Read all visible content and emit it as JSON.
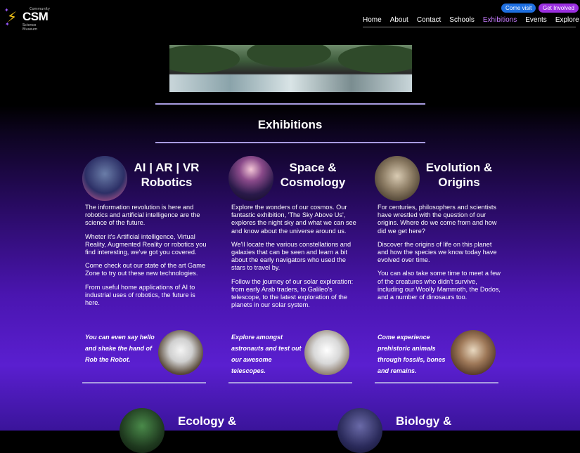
{
  "header": {
    "logo": {
      "top_text": "Community",
      "main": "CSM",
      "sub_text": "Science Museum"
    },
    "buttons": {
      "visit": "Come visit",
      "involved": "Get Involved"
    },
    "nav": [
      "Home",
      "About",
      "Contact",
      "Schools",
      "Exhibitions",
      "Events",
      "Explore"
    ],
    "active_nav": "Exhibitions"
  },
  "page": {
    "title": "Exhibitions"
  },
  "columns": [
    {
      "title_line1": "AI | AR | VR",
      "title_line2": "Robotics",
      "paragraphs": [
        "The information revolution is here and robotics and artificial intelligence are the science of the future.",
        "Wheter it's Artificial intelligence, Virtual Reality, Augmented Reality or robotics you find interesting, we've got you covered.",
        "Come check out our state of the art Game Zone to try out these new technologies.",
        "From useful home applications of AI to industrial uses of robotics, the future is here."
      ],
      "quote": "You can even say hello and shake the hand of Rob the Robot."
    },
    {
      "title_line1": "Space &",
      "title_line2": "Cosmology",
      "paragraphs": [
        "Explore the wonders of our cosmos. Our fantastic exhibition, 'The Sky Above Us', explores the night sky and what we can see and know about the universe around us.",
        "We'll locate the various constellations and galaxies that can be seen and learn a bit about the early navigators who used the stars to travel by.",
        "Follow the journey of our solar exploration: from early Arab traders, to Galileo's telescope, to the latest exploration of the planets in our solar system."
      ],
      "quote": "Explore amongst astronauts and test out our awesome telescopes."
    },
    {
      "title_line1": "Evolution &",
      "title_line2": "Origins",
      "paragraphs": [
        "For centuries, philosophers and scientists have wrestled with the question of our origins. Where do we come from and how did we get here?",
        "Discover the origins of life on this planet and how the species we know today have evolved over time.",
        "You can also take some time to meet a few of the creatures who didn't survive, including our Woolly Mammoth, the Dodos, and a number of dinosaurs too."
      ],
      "quote": "Come experience prehistoric animals through fossils, bones and remains."
    }
  ],
  "bottom": [
    {
      "title": "Ecology &"
    },
    {
      "title": "Biology &"
    }
  ],
  "colors": {
    "accent_purple": "#c77dff",
    "rule": "#a89be0",
    "visit_pill": "#1e6fe0",
    "involved_pill": "#9b2fe0"
  }
}
